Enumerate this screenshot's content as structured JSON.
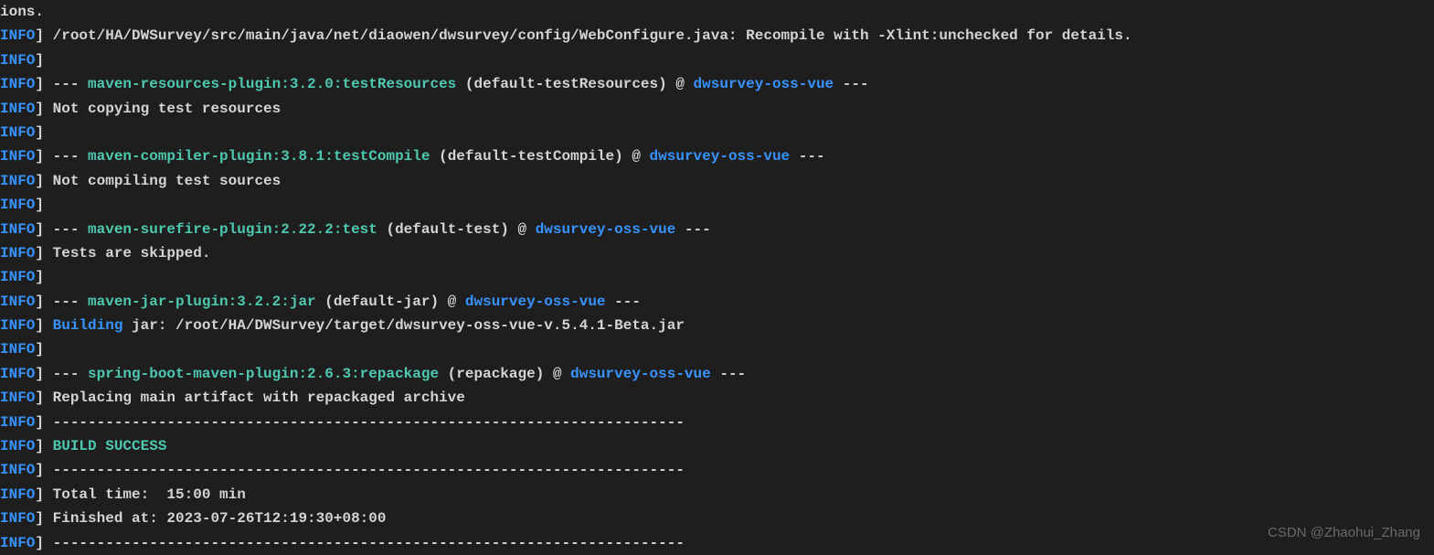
{
  "lines": {
    "l0_partial": "ions.",
    "l1_path": "/root/HA/DWSurvey/src/main/java/net/diaowen/dwsurvey/config/WebConfigure.java: Recompile with -Xlint:unchecked for details.",
    "l3_dashes1": "--- ",
    "l3_plugin": "maven-resources-plugin:3.2.0:testResources",
    "l3_goal": " (default-testResources) @ ",
    "l3_project": "dwsurvey-oss-vue",
    "l3_dashes2": " ---",
    "l4_text": "Not copying test resources",
    "l6_dashes1": "--- ",
    "l6_plugin": "maven-compiler-plugin:3.8.1:testCompile",
    "l6_goal": " (default-testCompile) @ ",
    "l6_project": "dwsurvey-oss-vue",
    "l6_dashes2": " ---",
    "l7_text": "Not compiling test sources",
    "l9_dashes1": "--- ",
    "l9_plugin": "maven-surefire-plugin:2.22.2:test",
    "l9_goal": " (default-test) @ ",
    "l9_project": "dwsurvey-oss-vue",
    "l9_dashes2": " ---",
    "l10_text": "Tests are skipped.",
    "l12_dashes1": "--- ",
    "l12_plugin": "maven-jar-plugin:3.2.2:jar",
    "l12_goal": " (default-jar) @ ",
    "l12_project": "dwsurvey-oss-vue",
    "l12_dashes2": " ---",
    "l13_building": "Building",
    "l13_jar": " jar: /root/HA/DWSurvey/target/dwsurvey-oss-vue-v.5.4.1-Beta.jar",
    "l15_dashes1": "--- ",
    "l15_plugin": "spring-boot-maven-plugin:2.6.3:repackage",
    "l15_goal": " (repackage) @ ",
    "l15_project": "dwsurvey-oss-vue",
    "l15_dashes2": " ---",
    "l16_text": "Replacing main artifact with repackaged archive",
    "l17_dashes": "------------------------------------------------------------------------",
    "l18_text": "BUILD SUCCESS",
    "l19_dashes": "------------------------------------------------------------------------",
    "l20_text": "Total time:  15:00 min",
    "l21_text": "Finished at: 2023-07-26T12:19:30+08:00",
    "l22_dashes": "------------------------------------------------------------------------"
  },
  "info_label": "INFO",
  "watermark": "CSDN @Zhaohui_Zhang"
}
